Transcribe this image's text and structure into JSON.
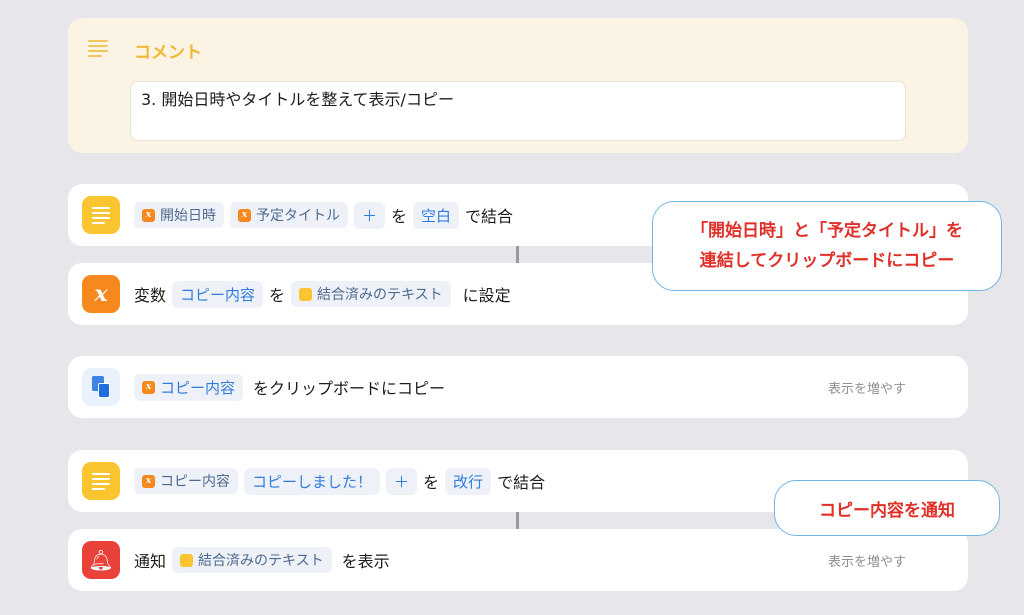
{
  "comment": {
    "title": "コメント",
    "text": "3. 開始日時やタイトルを整えて表示/コピー"
  },
  "action1": {
    "token1": "開始日時",
    "token2": "予定タイトル",
    "plus": "＋",
    "word_wo": "を",
    "separator": "空白",
    "verb": "で結合"
  },
  "action2": {
    "prefix": "変数",
    "var_name": "コピー内容",
    "word_wo": "を",
    "token": "結合済みのテキスト",
    "verb": "に設定"
  },
  "action3": {
    "token": "コピー内容",
    "verb": "をクリップボードにコピー",
    "show_more": "表示を増やす"
  },
  "action4": {
    "token1": "コピー内容",
    "token2": "コピーしました！",
    "plus": "＋",
    "word_wo": "を",
    "separator": "改行",
    "verb": "で結合"
  },
  "action5": {
    "prefix": "通知",
    "token": "結合済みのテキスト",
    "verb": "を表示",
    "show_more": "表示を増やす"
  },
  "callouts": {
    "c1_line1": "「開始日時」と「予定タイトル」を",
    "c1_line2": "連結してクリップボードにコピー",
    "c2": "コピー内容を通知"
  },
  "colors": {
    "accent_blue": "#2f7de1",
    "callout_red": "#e0302a",
    "comment_yellow": "#f2b731"
  }
}
